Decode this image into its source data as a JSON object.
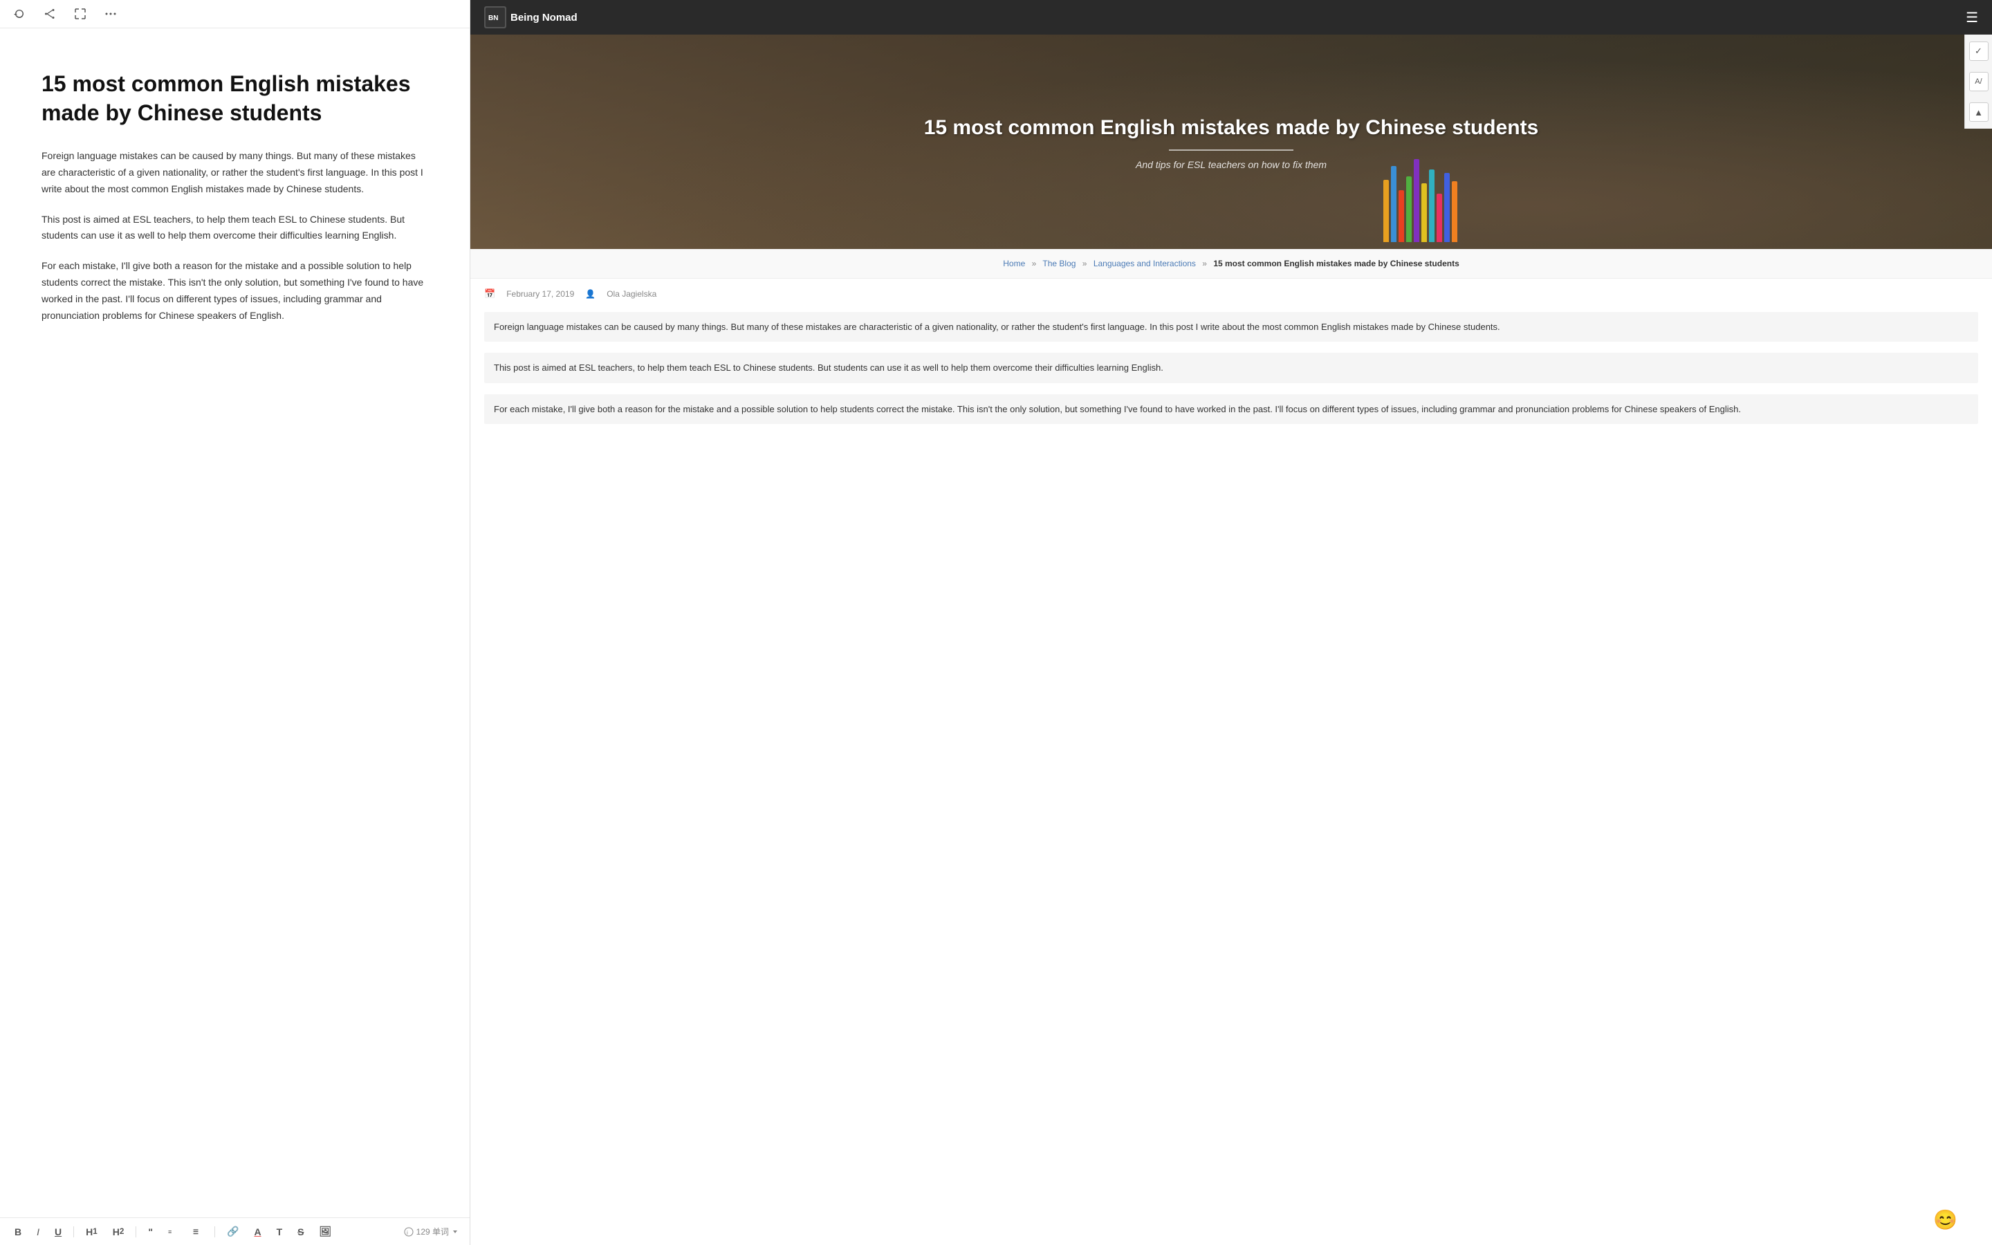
{
  "left": {
    "title": "15 most common English mistakes made by Chinese students",
    "paragraphs": [
      "Foreign language mistakes can be caused by many things. But many of these mistakes are characteristic of a given nationality, or rather the student's first language. In this post I write about the most common English mistakes made by Chinese students.",
      "This post is aimed at ESL teachers, to help them teach ESL to Chinese students. But students can use it as well to help them overcome their difficulties learning English.",
      "For each mistake, I'll give both a reason for the mistake and a possible solution to help students correct the mistake. This isn't the only solution, but something I've found to have worked in the past. I'll focus on different types of issues, including grammar and pronunciation problems for Chinese speakers of English."
    ],
    "word_count": "129 单词",
    "toolbar": {
      "refresh_title": "refresh",
      "share_title": "share",
      "expand_title": "expand",
      "more_title": "more"
    }
  },
  "right": {
    "nav": {
      "logo_text": "Being Nomad",
      "logo_icon": "🏕"
    },
    "hero": {
      "title": "15 most common English mistakes made by Chinese students",
      "subtitle": "And tips for ESL teachers on how to fix them"
    },
    "breadcrumb": {
      "home": "Home",
      "blog": "The Blog",
      "category": "Languages and Interactions",
      "current": "15 most common English mistakes made by Chinese students"
    },
    "meta": {
      "date": "February 17, 2019",
      "author": "Ola Jagielska"
    },
    "paragraphs": [
      "Foreign language mistakes can be caused by many things. But many of these mistakes are characteristic of a given nationality, or rather the student's first language. In this post I write about the most common English mistakes made by Chinese students.",
      "This post is aimed at ESL teachers, to help them teach ESL to Chinese students. But students can use it as well to help them overcome their difficulties learning English.",
      "For each mistake, I'll give both a reason for the mistake and a possible solution to help students correct the mistake. This isn't the only solution, but something I've found to have worked in the past. I'll focus on different types of issues, including grammar and pronunciation problems for Chinese speakers of English."
    ]
  },
  "format_buttons": [
    "B",
    "I",
    "U",
    "H1",
    "H2",
    "“",
    "OL",
    "UL",
    "🔗",
    "A",
    "T",
    "S",
    "🖼"
  ],
  "sidebar_icons": [
    "✓",
    "A/",
    "▲"
  ]
}
